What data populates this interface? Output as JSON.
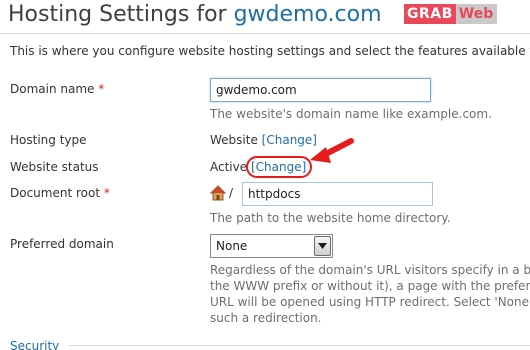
{
  "header": {
    "title_prefix": "Hosting Settings for ",
    "title_domain": "gwdemo.com",
    "logo_grab": "GRAB",
    "logo_web": "Web"
  },
  "intro": "This is where you configure website hosting settings and select the features available fo",
  "fields": {
    "domain_name": {
      "label": "Domain name",
      "required_mark": "*",
      "value": "gwdemo.com",
      "hint": "The website's domain name like example.com."
    },
    "hosting_type": {
      "label": "Hosting type",
      "value": "Website",
      "link": "[Change]"
    },
    "website_status": {
      "label": "Website status",
      "value": "Active",
      "link": "[Change]"
    },
    "document_root": {
      "label": "Document root",
      "required_mark": "*",
      "separator": "/",
      "value": "httpdocs",
      "hint": "The path to the website home directory.",
      "icon": "home-icon"
    },
    "preferred_domain": {
      "label": "Preferred domain",
      "selected": "None",
      "hint_lines": [
        "Regardless of the domain's URL visitors specify in a br",
        "the WWW prefix or without it), a page with the prefer",
        "URL will be opened using HTTP redirect. Select 'None' t",
        "such a redirection."
      ]
    }
  },
  "section": {
    "security": "Security"
  },
  "colors": {
    "link": "#1e6fa8",
    "required": "#e02020",
    "annotation": "#e81b1b",
    "logo_red": "#e8485a"
  }
}
